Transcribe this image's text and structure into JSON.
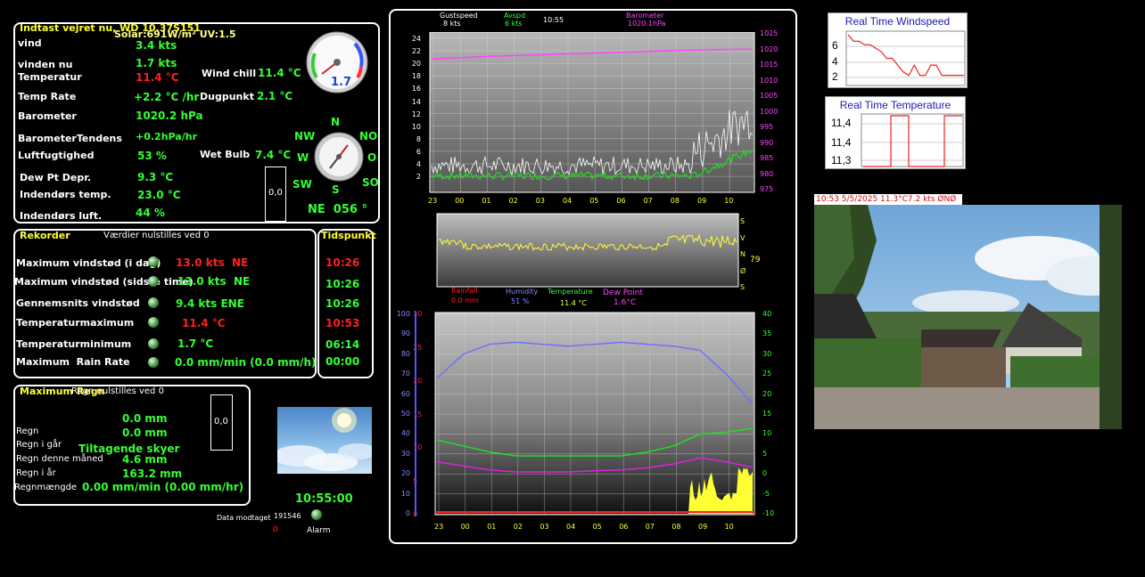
{
  "current": {
    "title": "Indtast vejret nu, WD 10.37S151",
    "solar": "Solar:691W/m² UV:1.5",
    "rows": [
      {
        "label": "vind",
        "value": "3.4 kts"
      },
      {
        "label": "vinden nu",
        "value": "1.7 kts"
      },
      {
        "label": "Temperatur",
        "value": "11.4 °C"
      },
      {
        "label": "Temp Rate",
        "value": "+2.2 °C /hr"
      },
      {
        "label": "Barometer",
        "value": "1020.2 hPa"
      },
      {
        "label": "BarometerTendens",
        "value": "+0.2hPa/hr"
      },
      {
        "label": "Luftfugtighed",
        "value": "53 %"
      },
      {
        "label": "Dew Pt Depr.",
        "value": "9.3 °C"
      },
      {
        "label": "Indendørs temp.",
        "value": "23.0 °C"
      },
      {
        "label": "Indendørs luft.",
        "value": "44 %"
      }
    ],
    "windchill_label": "Wind chill",
    "windchill_value": "11.4 °C",
    "dewpoint_label": "Dugpunkt",
    "dewpoint_value": "2.1 °C",
    "wetbulb_label": "Wet Bulb",
    "wetbulb_value": "7.4 °C",
    "gauge_value": "1.7",
    "box_value": "0,0",
    "compass": {
      "n": "N",
      "nw": "NW",
      "no": "NO",
      "w": "W",
      "o": "O",
      "sw": "SW",
      "s": "S",
      "so": "SO"
    },
    "direction": "NE  056 °"
  },
  "records": {
    "title": "Rekorder",
    "subtitle": "Værdier nulstilles ved 0",
    "time_title": "Tidspunkt",
    "rows": [
      {
        "label": "Maximum vindstød (i dag)",
        "value": "13.0 kts  NE",
        "time": "10:26"
      },
      {
        "label": "Maximum vindstød (sidste time)",
        "value": "13.0 kts  NE",
        "time": "10:26"
      },
      {
        "label": "Gennemsnits vindstød",
        "value": "9.4 kts ENE",
        "time": "10:26"
      },
      {
        "label": "Temperaturmaximum",
        "value": "11.4 °C",
        "time": "10:53"
      },
      {
        "label": "Temperaturminimum",
        "value": "1.7 °C",
        "time": "06:14"
      },
      {
        "label": "Maximum  Rain Rate",
        "value": "0.0 mm/min (0.0 mm/h)",
        "time": "00:00"
      }
    ]
  },
  "rain": {
    "title": "Maximum Regn",
    "subtitle": "Regn nulstilles ved 0",
    "values": [
      "0.0 mm",
      "0.0 mm"
    ],
    "labels": [
      "Regn",
      "Regn i går",
      "Regn denne måned",
      "Regn i år",
      "Regnmængde"
    ],
    "forecast": "Tiltagende skyer",
    "month": "4.6 mm",
    "year": "163.2 mm",
    "rate": "0.00 mm/min (0.00 mm/hr)",
    "box_value": "0,0"
  },
  "status": {
    "clock": "10:55:00",
    "data_label": "Data modtaget",
    "data_count": "191546",
    "data_zero": "0",
    "alarm": "Alarm"
  },
  "chart1": {
    "legend_gust": "Gustspeed",
    "legend_gust_val": "8 kts",
    "legend_avspd": "Avspd",
    "legend_avspd_val": "6 kts",
    "legend_time": "10:55",
    "legend_baro": "Barometer",
    "legend_baro_val": "1020.1hPa",
    "yleft": [
      "24",
      "22",
      "20",
      "18",
      "16",
      "14",
      "12",
      "10",
      "8",
      "6",
      "4",
      "2"
    ],
    "yright": [
      "1025",
      "1020",
      "1015",
      "1010",
      "1005",
      "1000",
      "995",
      "990",
      "985",
      "980",
      "975"
    ],
    "x": [
      "23",
      "00",
      "01",
      "02",
      "03",
      "04",
      "05",
      "06",
      "07",
      "08",
      "09",
      "10"
    ],
    "baro_values": [
      1017,
      1017.4,
      1017.8,
      1018.1,
      1018.4,
      1018.7,
      1019,
      1019.3,
      1019.6,
      1019.8,
      1020,
      1020.1
    ]
  },
  "chart2": {
    "dirs": [
      "S",
      "V",
      "N",
      "Ø",
      "S"
    ],
    "value": "79"
  },
  "chart3": {
    "legend_rain": "Rainfall",
    "legend_rain_val": "0.0 mm",
    "legend_hum": "Humidity",
    "legend_hum_val": "51 %",
    "legend_temp": "Temperature",
    "legend_temp_val": "11.4 °C",
    "legend_dew": "Dew Point",
    "legend_dew_val": "1.6°C",
    "yhum": [
      "100",
      "90",
      "80",
      "70",
      "60",
      "50",
      "40",
      "30",
      "20",
      "10",
      "0"
    ],
    "yrain": [
      "30",
      "25",
      "20",
      "15",
      "10",
      "5",
      "0"
    ],
    "ytemp": [
      "40",
      "35",
      "30",
      "25",
      "20",
      "15",
      "10",
      "5",
      "0",
      "-5",
      "-10"
    ],
    "x": [
      "23",
      "00",
      "01",
      "02",
      "03",
      "04",
      "05",
      "06",
      "07",
      "08",
      "09",
      "10"
    ],
    "humidity": [
      68,
      80,
      85,
      86,
      85,
      84,
      85,
      86,
      85,
      84,
      82,
      70,
      55
    ],
    "temperature": [
      8.5,
      7,
      5.5,
      4.5,
      4.5,
      4.5,
      4.5,
      4.5,
      5.5,
      7,
      10,
      10.5,
      11.4
    ],
    "dewpoint": [
      3,
      2,
      1,
      0.5,
      0.5,
      0.5,
      0.8,
      1,
      1.5,
      2.5,
      4,
      3,
      1.6
    ]
  },
  "minicharts": {
    "wind_title": "Real Time Windspeed",
    "wind_ticks": [
      "6",
      "4",
      "2"
    ],
    "wind_values": [
      7.5,
      6.5,
      6.5,
      6,
      6,
      5.5,
      5,
      4,
      4,
      3,
      2,
      1.5,
      3,
      1.5,
      1.5,
      3,
      3,
      1.5,
      1.5,
      1.5,
      1.5,
      1.5
    ],
    "temp_title": "Real Time Temperature",
    "temp_ticks": [
      "11,4",
      "11,4",
      "11,3"
    ]
  },
  "webcam": {
    "caption": "10:53 5/5/2025 11.3°C7.2 kts  ØNØ"
  }
}
